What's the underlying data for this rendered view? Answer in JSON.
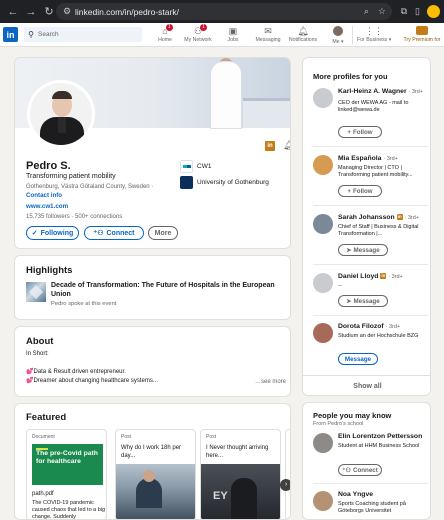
{
  "browser": {
    "url": "linkedin.com/in/pedro-stark/"
  },
  "nav": {
    "search_placeholder": "Search",
    "items": [
      {
        "label": "Home",
        "badge": "1"
      },
      {
        "label": "My Network",
        "badge": "1"
      },
      {
        "label": "Jobs",
        "badge": ""
      },
      {
        "label": "Messaging",
        "badge": ""
      },
      {
        "label": "Notifications",
        "badge": ""
      },
      {
        "label": "Me ▾",
        "badge": ""
      },
      {
        "label": "For Business ▾",
        "badge": ""
      },
      {
        "label": "Try Premium for",
        "badge": ""
      }
    ]
  },
  "profile": {
    "name": "Pedro S.",
    "headline": "Transforming patient mobility",
    "location": "Gothenburg, Västra Götaland County, Sweden ·",
    "contact_label": "Contact info",
    "website": "www.cw1.com",
    "connections": "15,735 followers · 500+ connections",
    "buttons": {
      "following": "Following",
      "connect": "Connect",
      "more": "More"
    },
    "orgs": [
      {
        "name": "CW1"
      },
      {
        "name": "University of Gothenburg"
      }
    ]
  },
  "highlights": {
    "title": "Highlights",
    "event_title": "Decade of Transformation: The Future of Hospitals in the European Union",
    "event_sub": "Pedro spoke at this event"
  },
  "about": {
    "title": "About",
    "lines": [
      "In Short:",
      "💕Data & Result driven entrepreneur.",
      "💕Dreamer about changing healthcare systems..."
    ],
    "see_more": "…see more"
  },
  "featured": {
    "title": "Featured",
    "items": [
      {
        "type": "Document",
        "thumb_text": "The pre-Covid path for healthcare",
        "file": "path.pdf",
        "desc": "The COVID-19 pandemic caused chaos that led to a big change. Suddenly"
      },
      {
        "type": "Post",
        "title": "Why do I work 18h per day..."
      },
      {
        "type": "Post",
        "title": "I Never thought arriving here...",
        "thumb_text": "EY"
      },
      {
        "type": "P"
      }
    ]
  },
  "more_profiles": {
    "title": "More profiles for you",
    "people": [
      {
        "name": "Karl-Heinz A. Wagner",
        "degree": "· 3rd+",
        "desc": "CEO der WEWA AG - mail to linked@wewa.de",
        "action": "Follow"
      },
      {
        "name": "Mia Española",
        "degree": "· 3rd+",
        "desc": "Managing Director | CTO | Transforming patient mobility...",
        "action": "Follow"
      },
      {
        "name": "Sarah Johansson",
        "degree": "· 3rd+",
        "desc": "Chief of Staff | Business & Digital Transformation |...",
        "action": "Message"
      },
      {
        "name": "Daniel Lloyd",
        "degree": "· 3rd+",
        "desc": "--",
        "action": "Message"
      },
      {
        "name": "Dorota Filozof",
        "degree": "· 3rd+",
        "desc": "Studium an der Hochschule BZG",
        "action": "Message"
      }
    ],
    "show_all": "Show all"
  },
  "pymk": {
    "title": "People you may know",
    "subtitle": "From Pedro's school",
    "people": [
      {
        "name": "Elin Lorentzon Pettersson",
        "desc": "Student at HHM Business School",
        "action": "Connect"
      },
      {
        "name": "Noa Yngve",
        "desc": "Sports Coaching student på Göteborgs Universitet",
        "action": ""
      }
    ]
  },
  "colors": {
    "linkedin_blue": "#0a66c2",
    "premium_gold": "#c37d16",
    "page_bg": "#f4f2ee",
    "notification_red": "#cb112d"
  }
}
